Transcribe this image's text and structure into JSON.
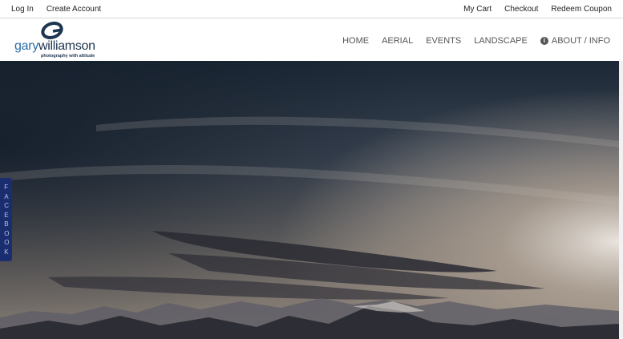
{
  "topbar": {
    "left": [
      "Log In",
      "Create Account"
    ],
    "right": [
      "My Cart",
      "Checkout",
      "Redeem Coupon"
    ]
  },
  "logo": {
    "name_part1": "gary",
    "name_part2": "williamson",
    "tagline": "photography with altitude"
  },
  "nav": {
    "items": [
      "HOME",
      "AERIAL",
      "EVENTS",
      "LANDSCAPE"
    ],
    "about": "ABOUT / INFO",
    "about_icon": "info-icon"
  },
  "social_tab": {
    "label": "FACEBOOK",
    "color": "#1a2d6e"
  },
  "hero": {
    "alt": "Mountain range under dramatic evening sky"
  }
}
